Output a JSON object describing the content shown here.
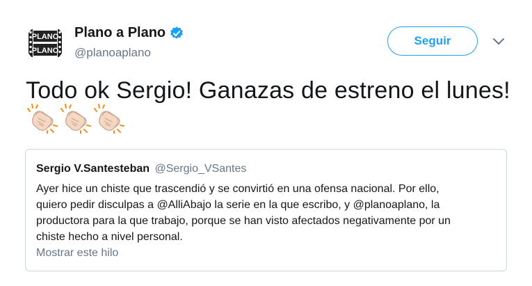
{
  "author": {
    "display_name": "Plano a Plano",
    "handle": "@planoaplano",
    "logo_text_1": "PLANO",
    "logo_text_2": "PLANO",
    "verified": true
  },
  "follow_label": "Seguir",
  "tweet_text": "Todo ok Sergio! Ganazas de estreno el lunes!",
  "emojis": [
    "clapping-hands",
    "clapping-hands",
    "clapping-hands"
  ],
  "quoted_tweet": {
    "name": "Sergio V.Santesteban",
    "handle": "@Sergio_VSantes",
    "lines": [
      "Ayer hice un chiste que trascendió y se convirtió en una ofensa nacional. Por ello,",
      "quiero pedir disculpas a @AlliAbajo la serie en la que escribo, y @planoaplano, la",
      "productora para la que trabajo, porque se han visto afectados negativamente por un",
      "chiste hecho a nivel personal."
    ],
    "show_thread": "Mostrar este hilo"
  },
  "colors": {
    "accent": "#1da1f2",
    "secondary_text": "#657786",
    "border": "#ccd6dd"
  }
}
